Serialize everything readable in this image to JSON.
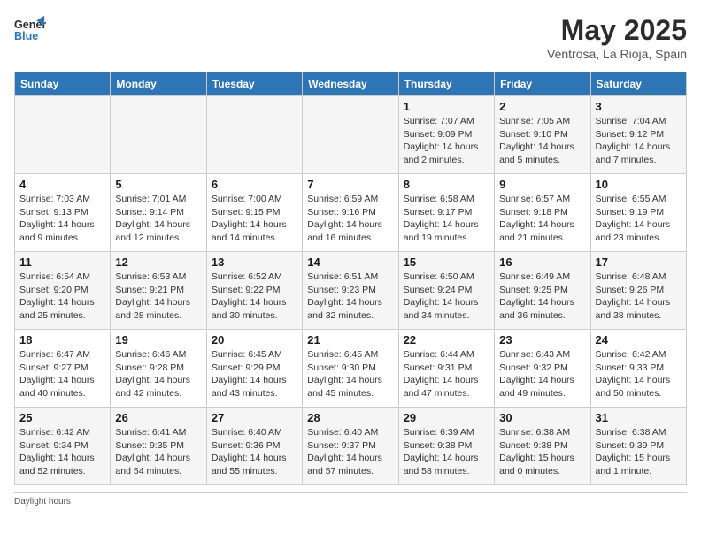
{
  "header": {
    "logo_line1": "General",
    "logo_line2": "Blue",
    "month": "May 2025",
    "location": "Ventrosa, La Rioja, Spain"
  },
  "weekdays": [
    "Sunday",
    "Monday",
    "Tuesday",
    "Wednesday",
    "Thursday",
    "Friday",
    "Saturday"
  ],
  "weeks": [
    [
      {
        "day": "",
        "info": ""
      },
      {
        "day": "",
        "info": ""
      },
      {
        "day": "",
        "info": ""
      },
      {
        "day": "",
        "info": ""
      },
      {
        "day": "1",
        "info": "Sunrise: 7:07 AM\nSunset: 9:09 PM\nDaylight: 14 hours and 2 minutes."
      },
      {
        "day": "2",
        "info": "Sunrise: 7:05 AM\nSunset: 9:10 PM\nDaylight: 14 hours and 5 minutes."
      },
      {
        "day": "3",
        "info": "Sunrise: 7:04 AM\nSunset: 9:12 PM\nDaylight: 14 hours and 7 minutes."
      }
    ],
    [
      {
        "day": "4",
        "info": "Sunrise: 7:03 AM\nSunset: 9:13 PM\nDaylight: 14 hours and 9 minutes."
      },
      {
        "day": "5",
        "info": "Sunrise: 7:01 AM\nSunset: 9:14 PM\nDaylight: 14 hours and 12 minutes."
      },
      {
        "day": "6",
        "info": "Sunrise: 7:00 AM\nSunset: 9:15 PM\nDaylight: 14 hours and 14 minutes."
      },
      {
        "day": "7",
        "info": "Sunrise: 6:59 AM\nSunset: 9:16 PM\nDaylight: 14 hours and 16 minutes."
      },
      {
        "day": "8",
        "info": "Sunrise: 6:58 AM\nSunset: 9:17 PM\nDaylight: 14 hours and 19 minutes."
      },
      {
        "day": "9",
        "info": "Sunrise: 6:57 AM\nSunset: 9:18 PM\nDaylight: 14 hours and 21 minutes."
      },
      {
        "day": "10",
        "info": "Sunrise: 6:55 AM\nSunset: 9:19 PM\nDaylight: 14 hours and 23 minutes."
      }
    ],
    [
      {
        "day": "11",
        "info": "Sunrise: 6:54 AM\nSunset: 9:20 PM\nDaylight: 14 hours and 25 minutes."
      },
      {
        "day": "12",
        "info": "Sunrise: 6:53 AM\nSunset: 9:21 PM\nDaylight: 14 hours and 28 minutes."
      },
      {
        "day": "13",
        "info": "Sunrise: 6:52 AM\nSunset: 9:22 PM\nDaylight: 14 hours and 30 minutes."
      },
      {
        "day": "14",
        "info": "Sunrise: 6:51 AM\nSunset: 9:23 PM\nDaylight: 14 hours and 32 minutes."
      },
      {
        "day": "15",
        "info": "Sunrise: 6:50 AM\nSunset: 9:24 PM\nDaylight: 14 hours and 34 minutes."
      },
      {
        "day": "16",
        "info": "Sunrise: 6:49 AM\nSunset: 9:25 PM\nDaylight: 14 hours and 36 minutes."
      },
      {
        "day": "17",
        "info": "Sunrise: 6:48 AM\nSunset: 9:26 PM\nDaylight: 14 hours and 38 minutes."
      }
    ],
    [
      {
        "day": "18",
        "info": "Sunrise: 6:47 AM\nSunset: 9:27 PM\nDaylight: 14 hours and 40 minutes."
      },
      {
        "day": "19",
        "info": "Sunrise: 6:46 AM\nSunset: 9:28 PM\nDaylight: 14 hours and 42 minutes."
      },
      {
        "day": "20",
        "info": "Sunrise: 6:45 AM\nSunset: 9:29 PM\nDaylight: 14 hours and 43 minutes."
      },
      {
        "day": "21",
        "info": "Sunrise: 6:45 AM\nSunset: 9:30 PM\nDaylight: 14 hours and 45 minutes."
      },
      {
        "day": "22",
        "info": "Sunrise: 6:44 AM\nSunset: 9:31 PM\nDaylight: 14 hours and 47 minutes."
      },
      {
        "day": "23",
        "info": "Sunrise: 6:43 AM\nSunset: 9:32 PM\nDaylight: 14 hours and 49 minutes."
      },
      {
        "day": "24",
        "info": "Sunrise: 6:42 AM\nSunset: 9:33 PM\nDaylight: 14 hours and 50 minutes."
      }
    ],
    [
      {
        "day": "25",
        "info": "Sunrise: 6:42 AM\nSunset: 9:34 PM\nDaylight: 14 hours and 52 minutes."
      },
      {
        "day": "26",
        "info": "Sunrise: 6:41 AM\nSunset: 9:35 PM\nDaylight: 14 hours and 54 minutes."
      },
      {
        "day": "27",
        "info": "Sunrise: 6:40 AM\nSunset: 9:36 PM\nDaylight: 14 hours and 55 minutes."
      },
      {
        "day": "28",
        "info": "Sunrise: 6:40 AM\nSunset: 9:37 PM\nDaylight: 14 hours and 57 minutes."
      },
      {
        "day": "29",
        "info": "Sunrise: 6:39 AM\nSunset: 9:38 PM\nDaylight: 14 hours and 58 minutes."
      },
      {
        "day": "30",
        "info": "Sunrise: 6:38 AM\nSunset: 9:38 PM\nDaylight: 15 hours and 0 minutes."
      },
      {
        "day": "31",
        "info": "Sunrise: 6:38 AM\nSunset: 9:39 PM\nDaylight: 15 hours and 1 minute."
      }
    ]
  ],
  "note_label": "Daylight hours"
}
